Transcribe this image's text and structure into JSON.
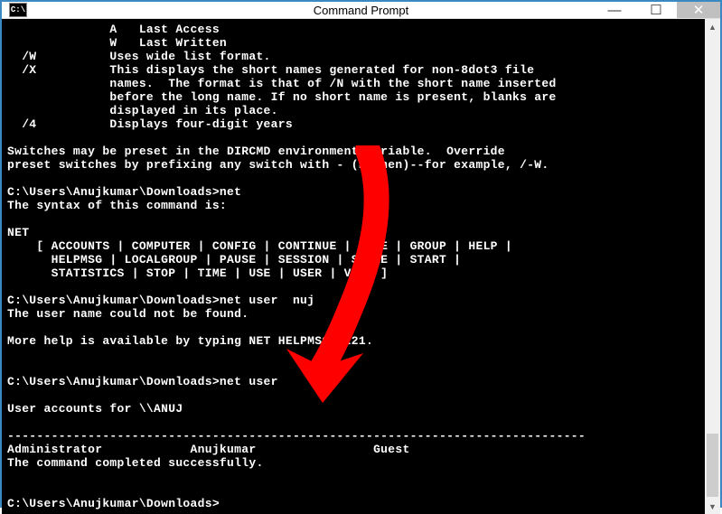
{
  "window": {
    "icon_label": "C:\\",
    "title": "Command Prompt",
    "buttons": {
      "min": "—",
      "max": "☐",
      "close": "✕"
    }
  },
  "terminal": {
    "lines": [
      "              A   Last Access",
      "              W   Last Written",
      "  /W          Uses wide list format.",
      "  /X          This displays the short names generated for non-8dot3 file",
      "              names.  The format is that of /N with the short name inserted",
      "              before the long name. If no short name is present, blanks are",
      "              displayed in its place.",
      "  /4          Displays four-digit years",
      "",
      "Switches may be preset in the DIRCMD environment variable.  Override",
      "preset switches by prefixing any switch with - (hyphen)--for example, /-W.",
      "",
      "C:\\Users\\Anujkumar\\Downloads>net",
      "The syntax of this command is:",
      "",
      "NET",
      "    [ ACCOUNTS | COMPUTER | CONFIG | CONTINUE | FILE | GROUP | HELP |",
      "      HELPMSG | LOCALGROUP | PAUSE | SESSION | SHARE | START |",
      "      STATISTICS | STOP | TIME | USE | USER | VIEW ]",
      "",
      "C:\\Users\\Anujkumar\\Downloads>net user  nuj",
      "The user name could not be found.",
      "",
      "More help is available by typing NET HELPMSG 2221.",
      "",
      "",
      "C:\\Users\\Anujkumar\\Downloads>net user",
      "",
      "User accounts for \\\\ANUJ",
      "",
      "-------------------------------------------------------------------------------",
      "Administrator            Anujkumar                Guest",
      "The command completed successfully.",
      "",
      "",
      "C:\\Users\\Anujkumar\\Downloads>"
    ]
  },
  "arrow": {
    "color": "#ff0000"
  }
}
